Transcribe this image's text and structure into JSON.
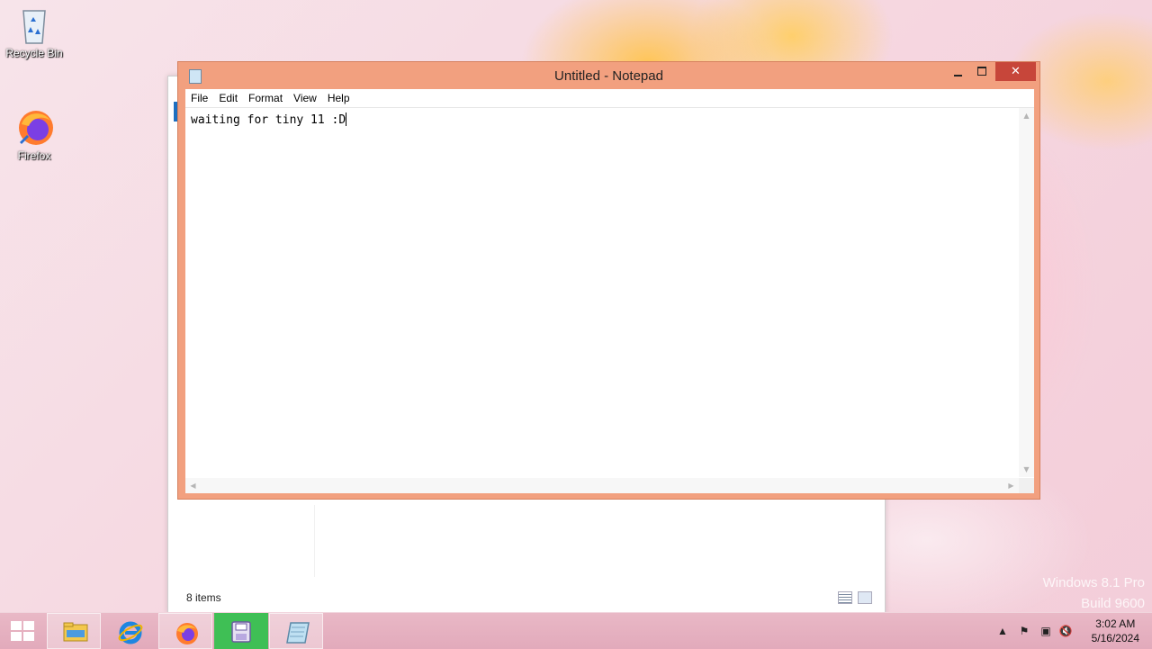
{
  "desktop": {
    "icons": [
      {
        "label": "Recycle Bin",
        "icon": "recycle-bin-icon"
      },
      {
        "label": "Firefox",
        "icon": "firefox-icon"
      }
    ],
    "watermark": {
      "line1": "Windows 8.1 Pro",
      "line2": "Build 9600"
    }
  },
  "explorer": {
    "status": "8 items"
  },
  "notepad": {
    "title": "Untitled - Notepad",
    "menu": [
      "File",
      "Edit",
      "Format",
      "View",
      "Help"
    ],
    "content": "waiting for tiny 11 :D",
    "accent_color": "#f2a07f",
    "close_color": "#c7463a"
  },
  "taskbar": {
    "buttons": [
      {
        "name": "start",
        "icon": "windows-logo-icon"
      },
      {
        "name": "file-explorer",
        "icon": "folder-icon"
      },
      {
        "name": "internet-explorer",
        "icon": "ie-icon"
      },
      {
        "name": "firefox",
        "icon": "firefox-icon"
      },
      {
        "name": "app",
        "icon": "floppy-icon"
      },
      {
        "name": "notepad",
        "icon": "notepad-icon"
      }
    ],
    "tray": {
      "time": "3:02 AM",
      "date": "5/16/2024"
    }
  }
}
